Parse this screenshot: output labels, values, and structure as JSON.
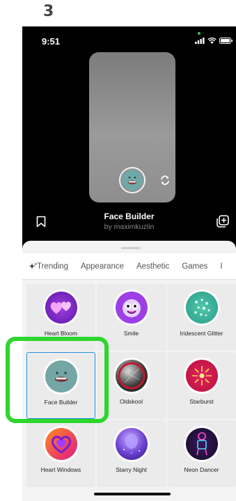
{
  "step": "3",
  "status_bar": {
    "time": "9:51"
  },
  "effect": {
    "title": "Face Builder",
    "creator": "by maximkuzlin"
  },
  "tabs": [
    "Trending",
    "Appearance",
    "Aesthetic",
    "Games"
  ],
  "effects": [
    {
      "label": "Heart Bloom",
      "icon": "heart-bloom-icon"
    },
    {
      "label": "Smile",
      "icon": "smile-icon"
    },
    {
      "label": "Iridescent Glitter",
      "icon": "glitter-icon"
    },
    {
      "label": "Face Builder",
      "icon": "face-builder-icon"
    },
    {
      "label": "Oldskool",
      "icon": "oldskool-icon"
    },
    {
      "label": "Starburst",
      "icon": "starburst-icon"
    },
    {
      "label": "Heart Windows",
      "icon": "heart-windows-icon"
    },
    {
      "label": "Starry Night",
      "icon": "starry-night-icon"
    },
    {
      "label": "Neon Dancer",
      "icon": "neon-dancer-icon"
    }
  ],
  "colors": {
    "selection_border": "#1b8fe0",
    "highlight": "#2cd62c",
    "sheet_bg": "#f3f3f3"
  }
}
